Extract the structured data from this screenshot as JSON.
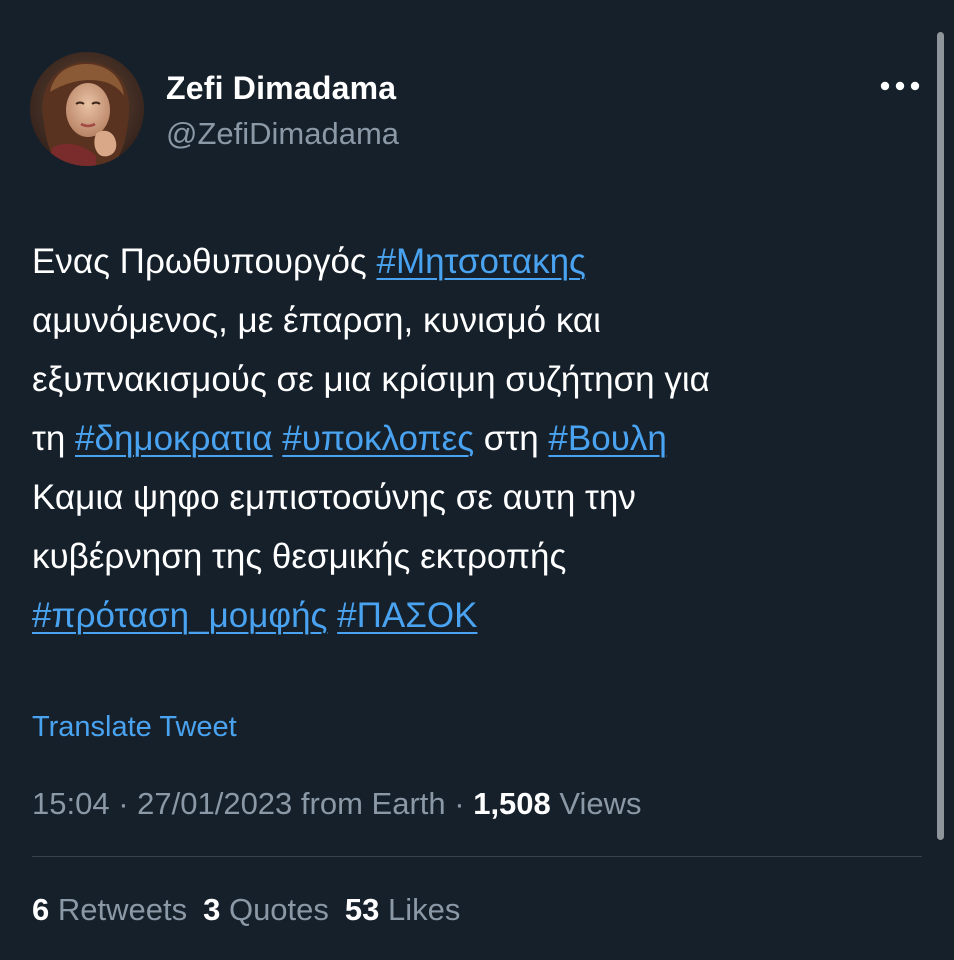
{
  "user": {
    "display_name": "Zefi Dimadama",
    "handle": "@ZefiDimadama"
  },
  "icons": {
    "more": "more-options-icon",
    "avatar": "profile-photo"
  },
  "tweet": {
    "lines": [
      [
        {
          "text": "Ενας Πρωθυπουργός ",
          "type": "text"
        },
        {
          "text": "#Μητσοτακης",
          "type": "hashtag"
        }
      ],
      [
        {
          "text": "αμυνόμενος, με έπαρση, κυνισμό και",
          "type": "text"
        }
      ],
      [
        {
          "text": "εξυπνακισμούς  σε μια κρίσιμη συζήτηση για",
          "type": "text"
        }
      ],
      [
        {
          "text": "τη ",
          "type": "text"
        },
        {
          "text": "#δημοκρατια",
          "type": "hashtag"
        },
        {
          "text": " ",
          "type": "text"
        },
        {
          "text": "#υποκλοπες",
          "type": "hashtag"
        },
        {
          "text": " στη ",
          "type": "text"
        },
        {
          "text": "#Βουλη",
          "type": "hashtag"
        }
      ],
      [
        {
          "text": "Καμια ψηφο εμπιστοσύνης σε αυτη την",
          "type": "text"
        }
      ],
      [
        {
          "text": "κυβέρνηση της θεσμικής εκτροπής",
          "type": "text"
        }
      ],
      [
        {
          "text": "#πρόταση_μομφής",
          "type": "hashtag"
        },
        {
          "text": " ",
          "type": "text"
        },
        {
          "text": "#ΠΑΣΟΚ",
          "type": "hashtag"
        }
      ]
    ],
    "translate_label": "Translate Tweet"
  },
  "meta": {
    "time": "15:04",
    "separator": " · ",
    "date": "27/01/2023",
    "source": "from Earth",
    "views_count": "1,508",
    "views_label": " Views"
  },
  "stats": [
    {
      "count": "6",
      "label": " Retweets",
      "name": "retweets"
    },
    {
      "count": "3",
      "label": " Quotes",
      "name": "quotes"
    },
    {
      "count": "53",
      "label": " Likes",
      "name": "likes"
    }
  ],
  "colors": {
    "background": "#15202b",
    "link": "#4aa3f0",
    "secondary_text": "#8b98a5",
    "divider": "#38444d"
  }
}
